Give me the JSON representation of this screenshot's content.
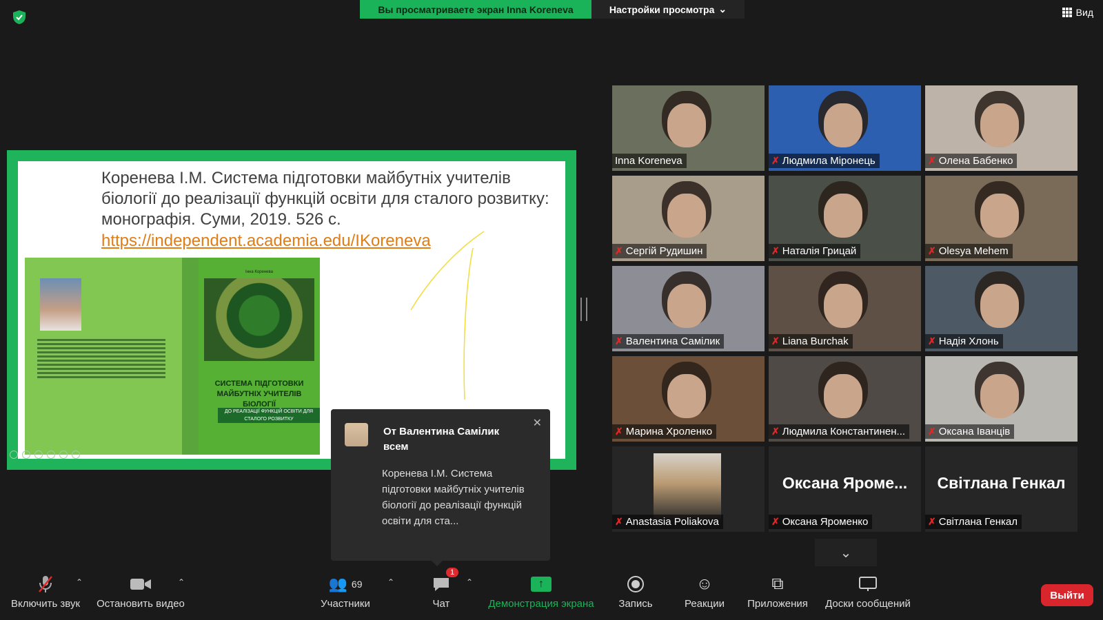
{
  "top_bar": {
    "share_banner": "Вы просматриваете экран Inna Koreneva",
    "view_options": "Настройки просмотра",
    "view_button": "Вид"
  },
  "slide": {
    "text": "Коренева І.М. Система підготовки майбутніх учителів біології до реалізації функцій освіти для сталого розвитку: монографія. Суми, 2019. 526 с.",
    "link": "https://independent.academia.edu/IKoreneva",
    "book": {
      "author": "Інна Коренева",
      "title": "СИСТЕМА ПІДГОТОВКИ МАЙБУТНІХ УЧИТЕЛІВ БІОЛОГІЇ",
      "subtitle": "ДО РЕАЛІЗАЦІЇ ФУНКЦІЙ ОСВІТИ ДЛЯ СТАЛОГО РОЗВИТКУ"
    }
  },
  "chat_popup": {
    "from": "От Валентина Самілик",
    "to": "всем",
    "message": "Коренева І.М. Система підготовки майбутніх учителів біології до реалізації функцій освіти для ста..."
  },
  "participants": [
    {
      "name": "Inna Koreneva",
      "muted": false,
      "bg": "#6b6f5e"
    },
    {
      "name": "Людмила Міронець",
      "muted": true,
      "bg": "#2d5fb0"
    },
    {
      "name": "Олена Бабенко",
      "muted": true,
      "bg": "#bdb3a8"
    },
    {
      "name": "Сергій Рудишин",
      "muted": true,
      "bg": "#a89c8a"
    },
    {
      "name": "Наталія Грицай",
      "muted": true,
      "bg": "#4a5048"
    },
    {
      "name": "Olesya Mehem",
      "muted": true,
      "bg": "#7a6a58"
    },
    {
      "name": "Валентина Самілик",
      "muted": true,
      "bg": "#8d8e95"
    },
    {
      "name": "Liana  Burchak",
      "muted": true,
      "bg": "#5e5044"
    },
    {
      "name": "Надія Хлонь",
      "muted": true,
      "bg": "#4d5a66"
    },
    {
      "name": "Марина Хроленко",
      "muted": true,
      "bg": "#6b4f38"
    },
    {
      "name": "Людмила Константинен...",
      "muted": true,
      "bg": "#4f4a46"
    },
    {
      "name": "Оксана Іванців",
      "muted": true,
      "bg": "#b9b7b2"
    },
    {
      "name": "Anastasia Poliakova",
      "muted": true,
      "bg": "#262626",
      "photo": true
    },
    {
      "name": "Оксана  Яроменко",
      "muted": true,
      "bg": "#262626",
      "big_name": "Оксана  Яроме..."
    },
    {
      "name": "Світлана Генкал",
      "muted": true,
      "bg": "#262626",
      "big_name": "Світлана Генкал"
    }
  ],
  "toolbar": {
    "unmute": "Включить звук",
    "stop_video": "Остановить видео",
    "participants": "Участники",
    "participants_count": "69",
    "chat": "Чат",
    "chat_badge": "1",
    "share_screen": "Демонстрация экрана",
    "record": "Запись",
    "reactions": "Реакции",
    "apps": "Приложения",
    "whiteboards": "Доски сообщений",
    "leave": "Выйти"
  }
}
